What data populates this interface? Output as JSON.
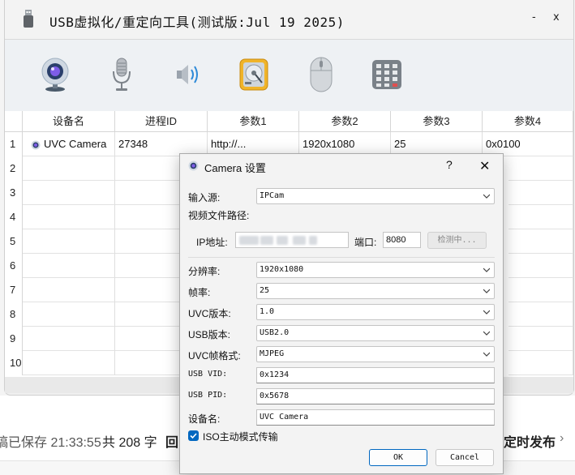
{
  "app": {
    "title": "USB虚拟化/重定向工具(测试版:Jul 19 2025)",
    "minimize": "-",
    "close": "x"
  },
  "toolbar": [
    {
      "name": "webcam-button",
      "icon": "webcam-icon"
    },
    {
      "name": "microphone-button",
      "icon": "microphone-icon"
    },
    {
      "name": "speaker-button",
      "icon": "speaker-icon"
    },
    {
      "name": "hard-disk-button",
      "icon": "hard-disk-icon"
    },
    {
      "name": "mouse-button",
      "icon": "mouse-icon"
    },
    {
      "name": "keypad-button",
      "icon": "keypad-icon"
    }
  ],
  "table": {
    "columns": [
      "设备名",
      "进程ID",
      "参数1",
      "参数2",
      "参数3",
      "参数4"
    ],
    "row_numbers": [
      "1",
      "2",
      "3",
      "4",
      "5",
      "6",
      "7",
      "8",
      "9",
      "10"
    ],
    "rows": [
      {
        "device": "UVC Camera",
        "pid": "27348",
        "p1": "http://...",
        "p2": "1920x1080",
        "p3": "25",
        "p4": "0x0100"
      }
    ]
  },
  "dialog": {
    "title": "Camera 设置",
    "help": "?",
    "close": "✕",
    "input_source_label": "输入源:",
    "input_source_value": "IPCam",
    "video_path_label": "视频文件路径:",
    "ip_label": "IP地址:",
    "port_label": "端口:",
    "port_value": "8080",
    "detect_label": "检测中...",
    "resolution_label": "分辨率:",
    "resolution_value": "1920x1080",
    "fps_label": "帧率:",
    "fps_value": "25",
    "uvc_version_label": "UVC版本:",
    "uvc_version_value": "1.0",
    "usb_version_label": "USB版本:",
    "usb_version_value": "USB2.0",
    "uvc_format_label": "UVC帧格式:",
    "uvc_format_value": "MJPEG",
    "usb_vid_label": "USB VID:",
    "usb_vid_value": "0x1234",
    "usb_pid_label": "USB PID:",
    "usb_pid_value": "0x5678",
    "device_name_label": "设备名:",
    "device_name_value": "UVC Camera",
    "iso_label": "ISO主动模式传输",
    "iso_checked": true,
    "ok": "OK",
    "cancel": "Cancel"
  },
  "background": {
    "saved_text": "稿已保存 21:33:55",
    "word_count": "共 208 字",
    "left_button": "回",
    "publish": "定时发布",
    "chevron": "›"
  },
  "colors": {
    "accent": "#0067c0"
  }
}
